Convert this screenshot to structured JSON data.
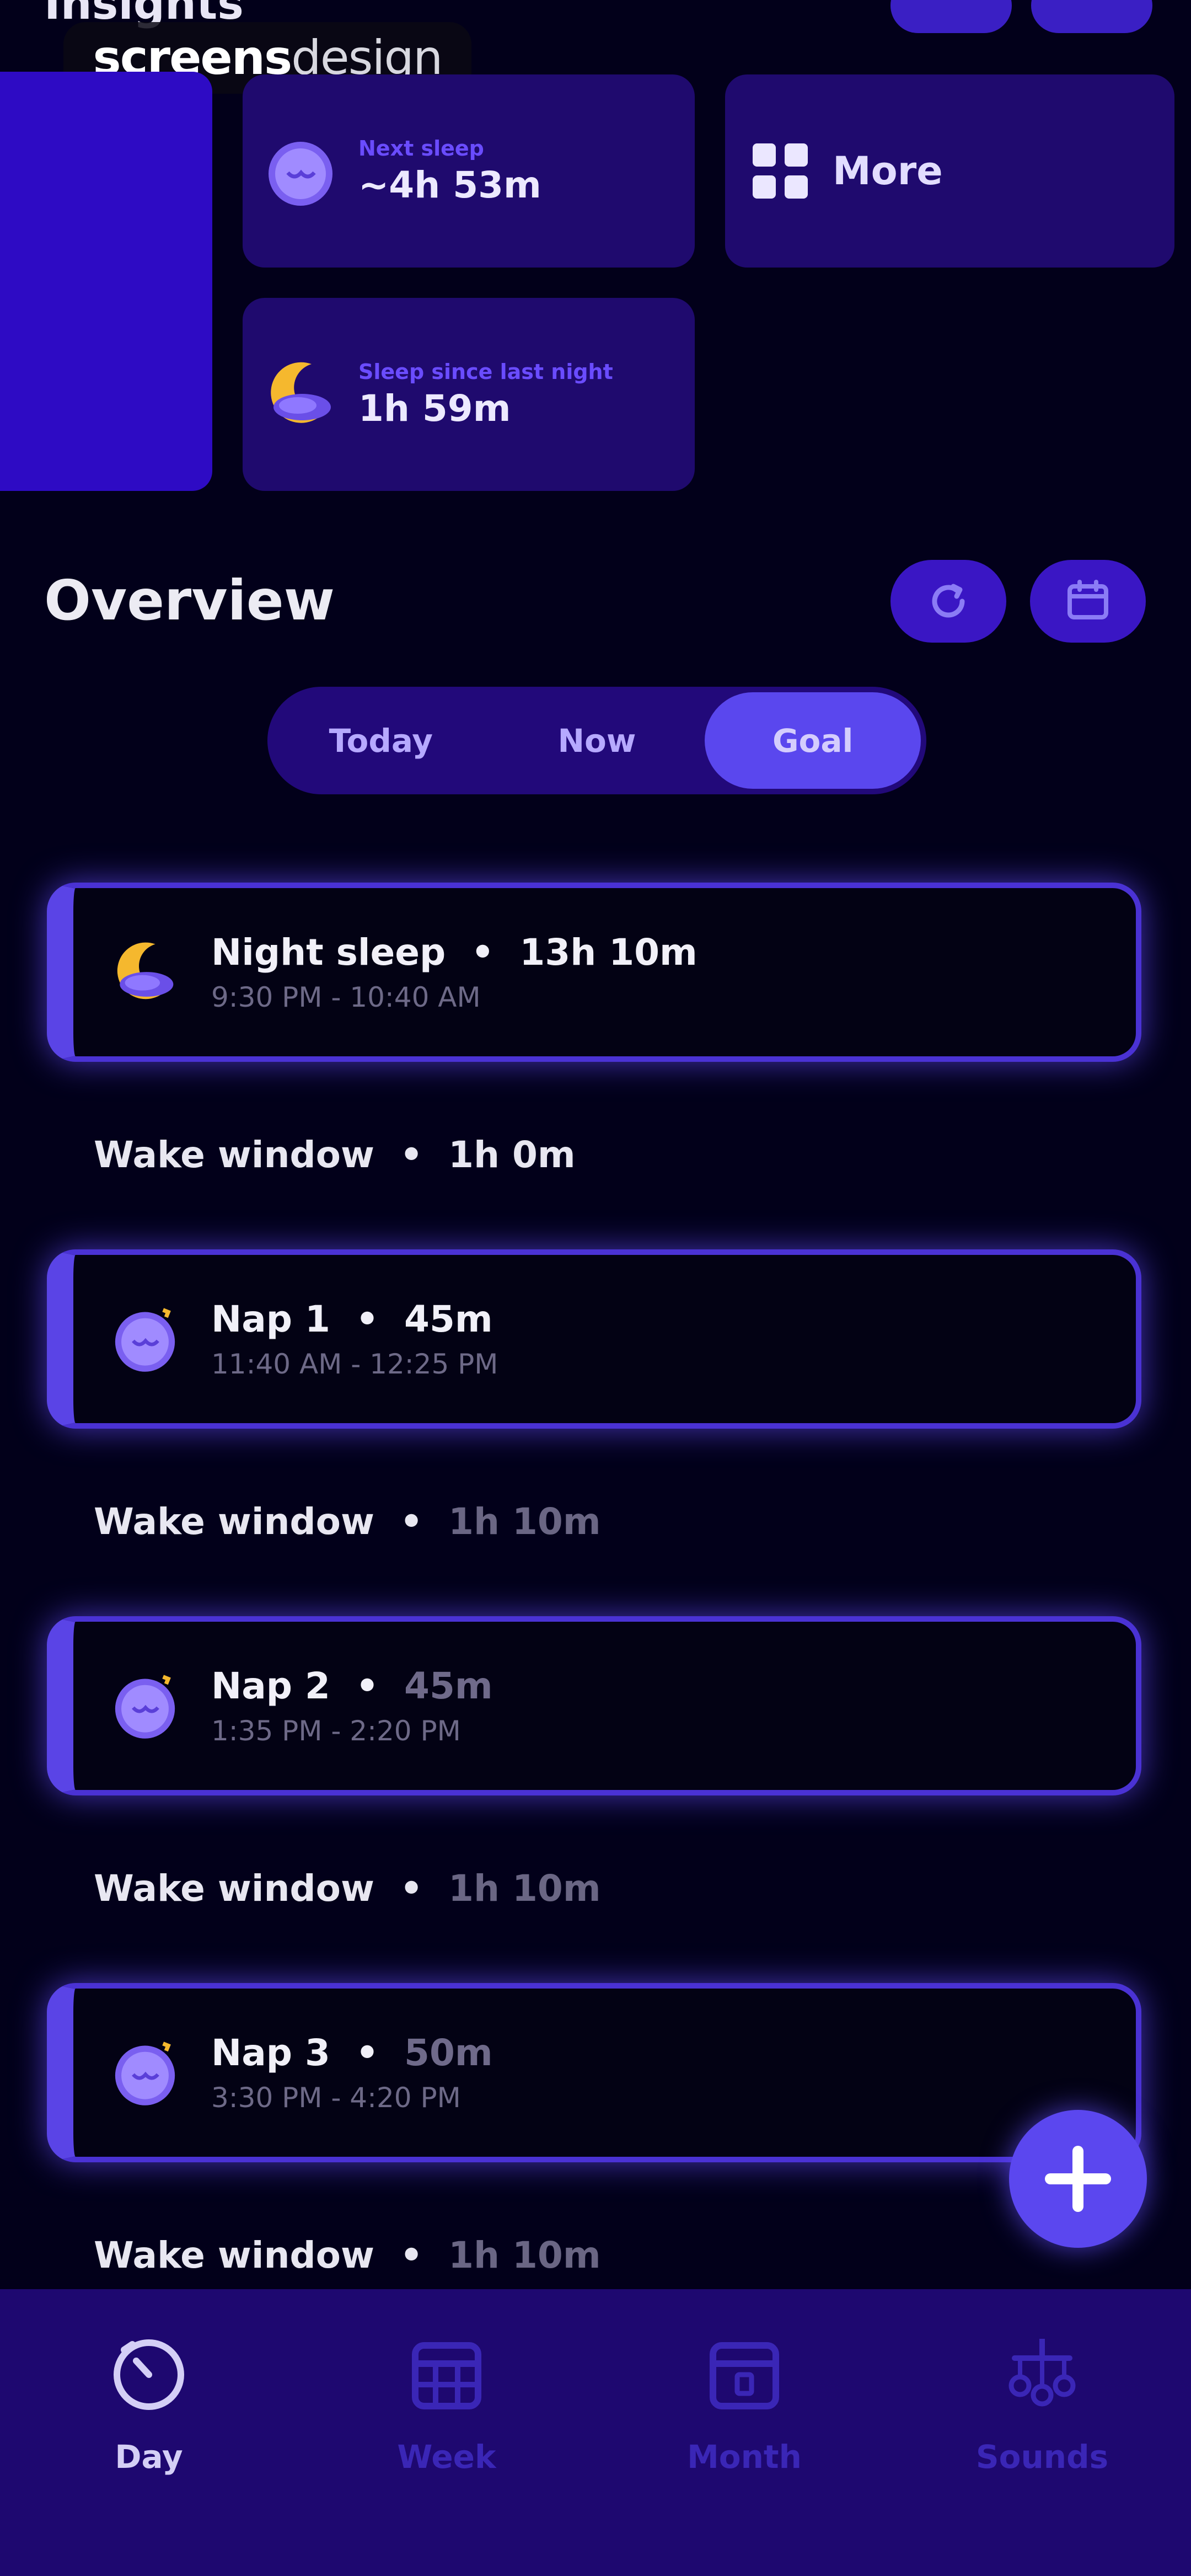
{
  "header": {
    "title": "Insights",
    "watermark_bold": "screens",
    "watermark_light": "design"
  },
  "insights": {
    "next_sleep": {
      "label": "Next sleep",
      "value": "~4h 53m"
    },
    "sleep_since": {
      "label": "Sleep since last night",
      "value": "1h 59m"
    },
    "more": {
      "label": "More"
    }
  },
  "overview": {
    "title": "Overview",
    "tabs": [
      {
        "label": "Today",
        "active": false
      },
      {
        "label": "Now",
        "active": false
      },
      {
        "label": "Goal",
        "active": true
      }
    ]
  },
  "schedule": [
    {
      "name": "Night sleep",
      "duration": "13h 10m",
      "time": "9:30 PM - 10:40 AM",
      "icon": "moon-icon"
    },
    {
      "name": "Nap 1",
      "duration": "45m",
      "time": "11:40 AM - 12:25 PM",
      "icon": "nap-icon"
    },
    {
      "name": "Nap 2",
      "duration": "45m",
      "time": "1:35 PM - 2:20 PM",
      "icon": "nap-icon"
    },
    {
      "name": "Nap 3",
      "duration": "50m",
      "time": "3:30 PM - 4:20 PM",
      "icon": "nap-icon"
    }
  ],
  "wake_windows": [
    {
      "label": "Wake window",
      "duration": "1h 0m"
    },
    {
      "label": "Wake window",
      "duration": "1h 10m"
    },
    {
      "label": "Wake window",
      "duration": "1h 10m"
    },
    {
      "label": "Wake window",
      "duration": "1h 10m"
    }
  ],
  "nav": [
    {
      "label": "Day",
      "icon": "timer-icon",
      "active": true
    },
    {
      "label": "Week",
      "icon": "calendar-week-icon",
      "active": false
    },
    {
      "label": "Month",
      "icon": "calendar-month-icon",
      "active": false
    },
    {
      "label": "Sounds",
      "icon": "mobile-icon",
      "active": false
    }
  ],
  "colors": {
    "background": "#02001a",
    "accent": "#5b47ef",
    "card": "#1f0a6e",
    "nav": "#1e0870"
  }
}
